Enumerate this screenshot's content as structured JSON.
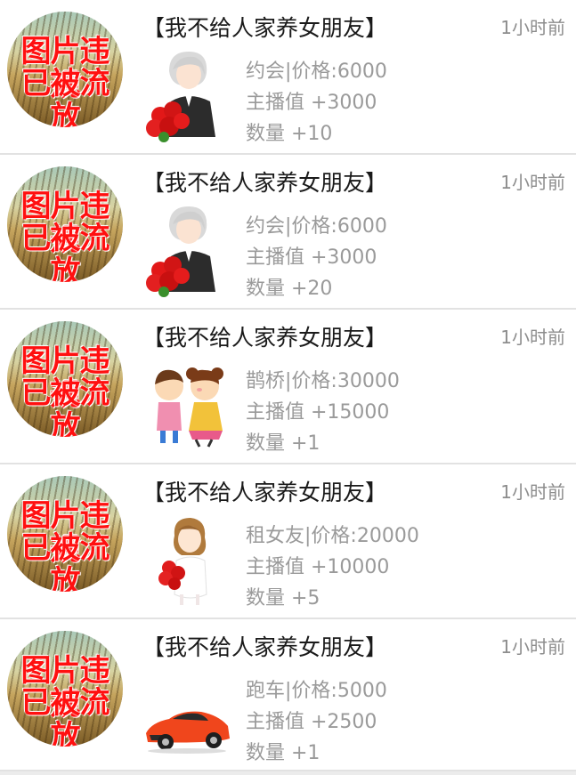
{
  "avatar_text": [
    "图片违规",
    "已被流放"
  ],
  "rows": [
    {
      "title": "【我不给人家养女朋友】",
      "time": "1小时前",
      "gift_icon": "boy-with-roses-icon",
      "gift_line": "约会|价格:6000",
      "anchor_line": "主播值 +3000",
      "qty_line": "数量 +10"
    },
    {
      "title": "【我不给人家养女朋友】",
      "time": "1小时前",
      "gift_icon": "boy-with-roses-icon",
      "gift_line": "约会|价格:6000",
      "anchor_line": "主播值 +3000",
      "qty_line": "数量 +20"
    },
    {
      "title": "【我不给人家养女朋友】",
      "time": "1小时前",
      "gift_icon": "couple-icon",
      "gift_line": "鹊桥|价格:30000",
      "anchor_line": "主播值 +15000",
      "qty_line": "数量 +1"
    },
    {
      "title": "【我不给人家养女朋友】",
      "time": "1小时前",
      "gift_icon": "bride-with-bouquet-icon",
      "gift_line": "租女友|价格:20000",
      "anchor_line": "主播值 +10000",
      "qty_line": "数量 +5"
    },
    {
      "title": "【我不给人家养女朋友】",
      "time": "1小时前",
      "gift_icon": "sports-car-icon",
      "gift_line": "跑车|价格:5000",
      "anchor_line": "主播值 +2500",
      "qty_line": "数量 +1"
    }
  ]
}
